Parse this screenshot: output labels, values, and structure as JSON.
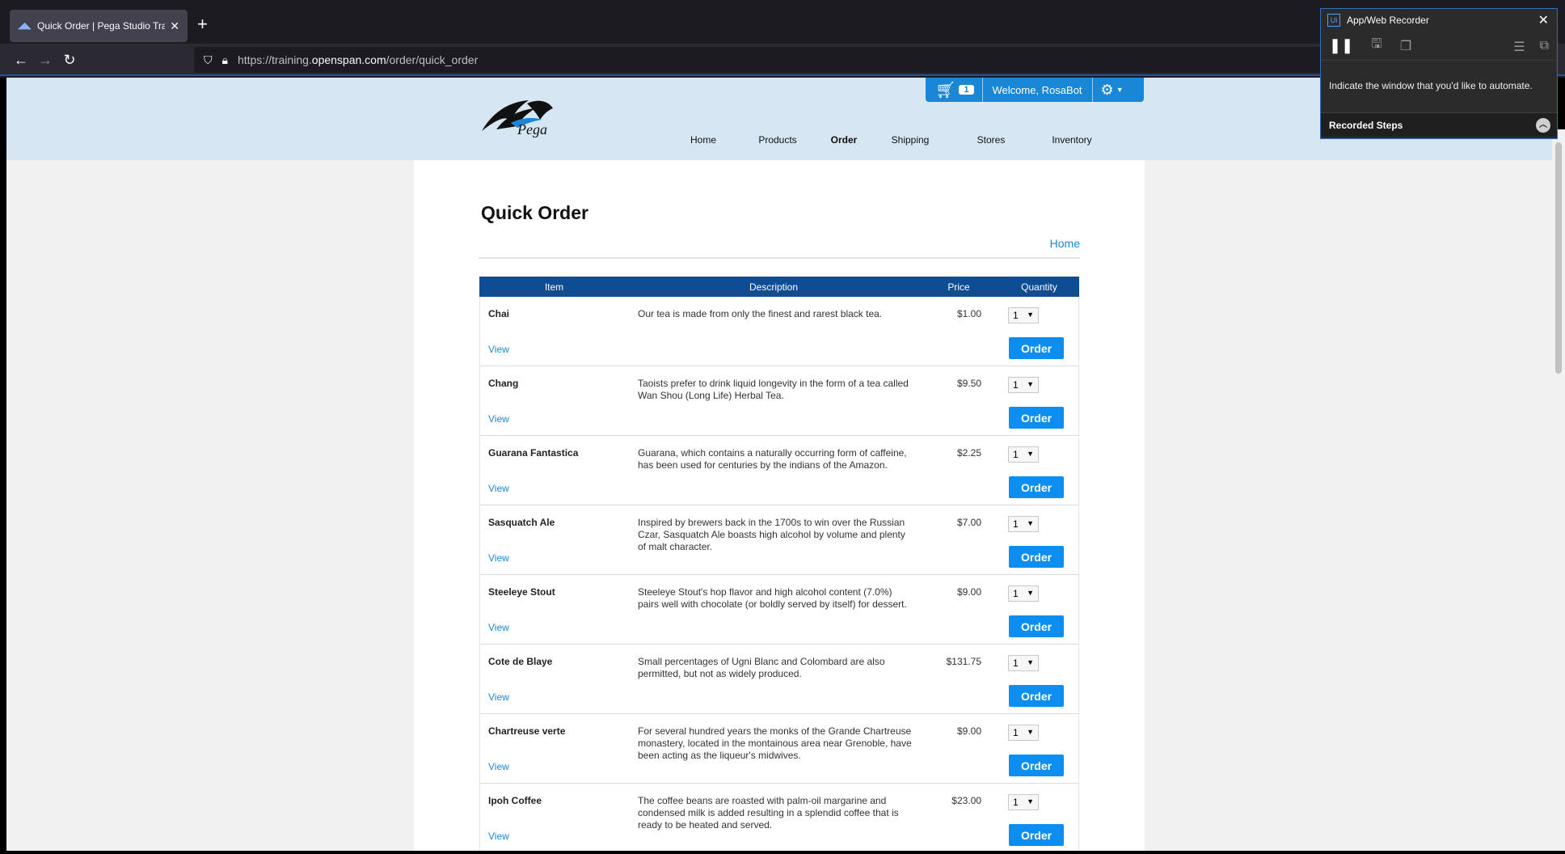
{
  "browser": {
    "tab_title": "Quick Order | Pega Studio Trai",
    "url_prefix": "https://training.",
    "url_domain": "openspan.com",
    "url_path": "/order/quick_order"
  },
  "header": {
    "logo_text": "Pega",
    "cart_count": "1",
    "welcome": "Welcome, RosaBot",
    "nav": [
      "Home",
      "Products",
      "Order",
      "Shipping",
      "Stores",
      "Inventory"
    ]
  },
  "page": {
    "title": "Quick Order",
    "breadcrumb": "Home",
    "columns": [
      "Item",
      "Description",
      "Price",
      "Quantity"
    ],
    "view_label": "View",
    "order_label": "Order",
    "items": [
      {
        "name": "Chai",
        "desc": "Our tea is made from only the finest and rarest black tea.",
        "price": "$1.00",
        "qty": "1"
      },
      {
        "name": "Chang",
        "desc": "Taoists prefer to drink liquid longevity in the form of a tea called Wan Shou (Long Life) Herbal Tea.",
        "price": "$9.50",
        "qty": "1"
      },
      {
        "name": "Guarana Fantastica",
        "desc": "Guarana, which contains a naturally occurring form of caffeine, has been used for centuries by the indians of the Amazon.",
        "price": "$2.25",
        "qty": "1"
      },
      {
        "name": "Sasquatch Ale",
        "desc": "Inspired by brewers back in the 1700s to win over the Russian Czar, Sasquatch Ale boasts high alcohol by volume and plenty of malt character.",
        "price": "$7.00",
        "qty": "1"
      },
      {
        "name": "Steeleye Stout",
        "desc": "Steeleye Stout's hop flavor and high alcohol content (7.0%) pairs well with chocolate (or boldly served by itself) for dessert.",
        "price": "$9.00",
        "qty": "1"
      },
      {
        "name": "Cote de Blaye",
        "desc": "Small percentages of Ugni Blanc and Colombard are also permitted, but not as widely produced.",
        "price": "$131.75",
        "qty": "1"
      },
      {
        "name": "Chartreuse verte",
        "desc": "For several hundred years the monks of the Grande Chartreuse monastery, located in the montainous area near Grenoble, have been acting as the liqueur's midwives.",
        "price": "$9.00",
        "qty": "1"
      },
      {
        "name": "Ipoh Coffee",
        "desc": "The coffee beans are roasted with palm-oil margarine and condensed milk is added resulting in a splendid coffee that is ready to be heated and served.",
        "price": "$23.00",
        "qty": "1"
      }
    ]
  },
  "recorder": {
    "title": "App/Web Recorder",
    "message": "Indicate the window that you'd like to automate.",
    "steps_label": "Recorded Steps"
  }
}
